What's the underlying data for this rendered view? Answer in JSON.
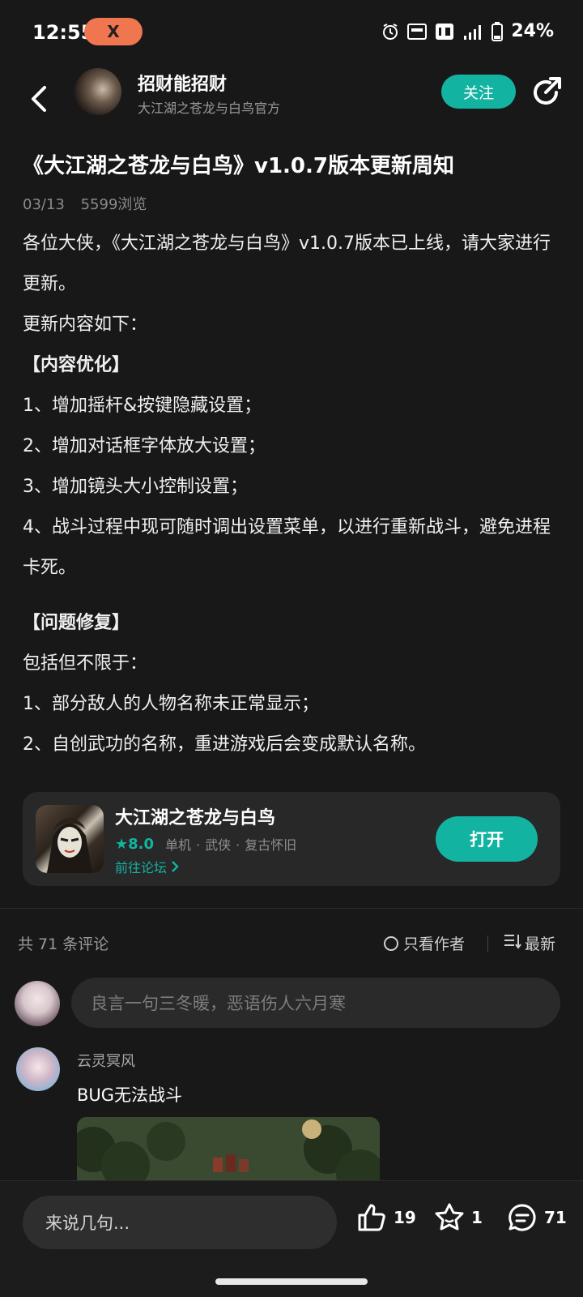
{
  "status_bar": {
    "time": "12:55",
    "battery": "24%",
    "badge_letter": "X"
  },
  "header": {
    "author_name": "招财能招财",
    "author_sub": "大江湖之苍龙与白鸟官方",
    "follow_label": "关注"
  },
  "article": {
    "title": "《大江湖之苍龙与白鸟》v1.0.7版本更新周知",
    "date": "03/13",
    "views": "5599浏览",
    "paragraphs": [
      "各位大侠，《大江湖之苍龙与白鸟》v1.0.7版本已上线，请大家进行更新。",
      "更新内容如下：",
      "【内容优化】",
      "1、增加摇杆&按键隐藏设置；",
      "2、增加对话框字体放大设置；",
      "3、增加镜头大小控制设置；",
      "4、战斗过程中现可随时调出设置菜单，以进行重新战斗，避免进程卡死。",
      "【问题修复】",
      "包括但不限于：",
      "1、部分敌人的人物名称未正常显示；",
      "2、自创武功的名称，重进游戏后会变成默认名称。"
    ]
  },
  "app_card": {
    "name": "大江湖之苍龙与白鸟",
    "rating": "8.0",
    "tags": [
      "单机",
      "·",
      "武侠",
      "·",
      "复古怀旧"
    ],
    "forum_link": "前往论坛",
    "open_label": "打开"
  },
  "comments": {
    "count_label": "共 71 条评论",
    "author_only_label": "只看作者",
    "sort_label": "最新",
    "input_placeholder": "良言一句三冬暖，恶语伤人六月寒",
    "items": [
      {
        "user": "云灵冥风",
        "text": "BUG无法战斗"
      }
    ]
  },
  "bottom_bar": {
    "input_placeholder": "来说几句...",
    "likes": "19",
    "favorites": "1",
    "comments": "71"
  },
  "colors": {
    "accent": "#13b3a1",
    "background": "#181818",
    "badge": "#f0764f"
  }
}
